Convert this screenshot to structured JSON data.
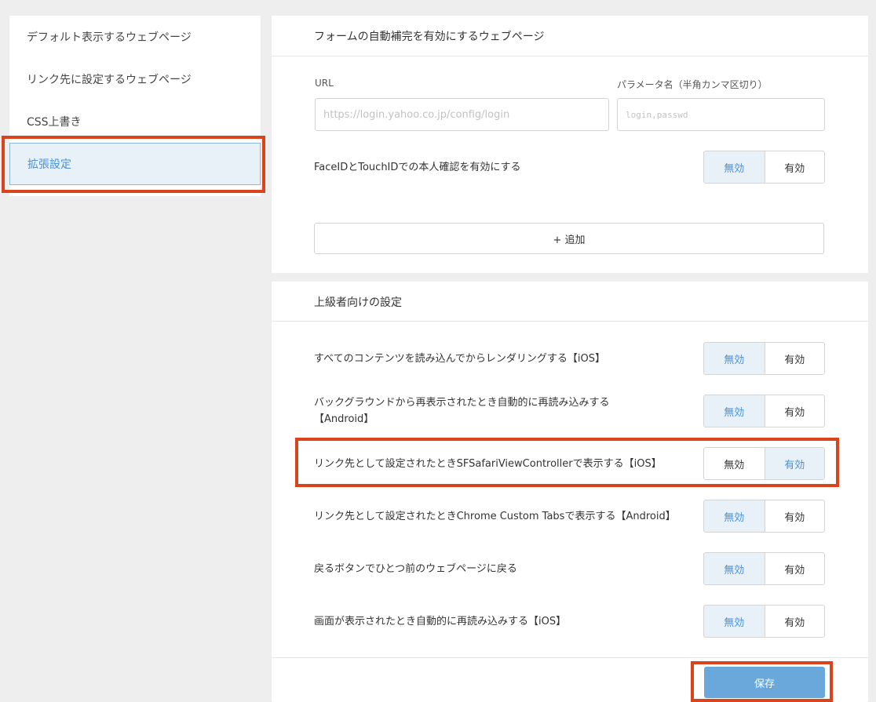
{
  "sidebar": {
    "items": [
      {
        "label": "デフォルト表示するウェブページ"
      },
      {
        "label": "リンク先に設定するウェブページ"
      },
      {
        "label": "CSS上書き"
      },
      {
        "label": "拡張設定"
      }
    ]
  },
  "autofill": {
    "title": "フォームの自動補完を有効にするウェブページ",
    "url_label": "URL",
    "url_placeholder": "https://login.yahoo.co.jp/config/login",
    "param_label": "パラメータ名（半角カンマ区切り）",
    "param_placeholder": "login,passwd",
    "faceid_label": "FaceIDとTouchIDでの本人確認を有効にする",
    "add_label": "+ 追加"
  },
  "toggle_labels": {
    "off": "無効",
    "on": "有効"
  },
  "advanced": {
    "title": "上級者向けの設定",
    "rows": [
      {
        "label": "すべてのコンテンツを読み込んでからレンダリングする【iOS】"
      },
      {
        "label": "バックグラウンドから再表示されたとき自動的に再読み込みする【Android】"
      },
      {
        "label": "リンク先として設定されたときSFSafariViewControllerで表示する【iOS】"
      },
      {
        "label": "リンク先として設定されたときChrome Custom Tabsで表示する【Android】"
      },
      {
        "label": "戻るボタンでひとつ前のウェブページに戻る"
      },
      {
        "label": "画面が表示されたとき自動的に再読み込みする【iOS】"
      }
    ],
    "save_label": "保存"
  },
  "colors": {
    "accent": "#4a90d9",
    "highlight": "#d9441c",
    "save": "#6aa8dc"
  }
}
